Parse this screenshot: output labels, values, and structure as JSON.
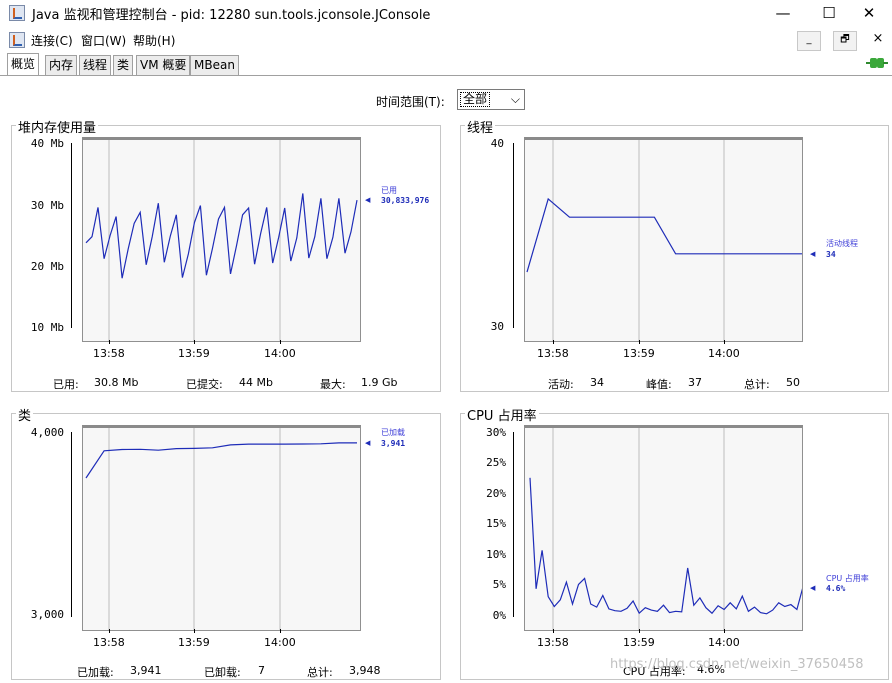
{
  "window": {
    "title": "Java 监视和管理控制台 - pid: 12280 sun.tools.jconsole.JConsole",
    "minimize": "—",
    "maximize": "☐",
    "close": "✕"
  },
  "menu": {
    "connect": "连接(C)",
    "window": "窗口(W)",
    "help": "帮助(H)",
    "mdi_min": "_",
    "mdi_restore": "🗗",
    "mdi_close": "×"
  },
  "tabs": [
    "概览",
    "内存",
    "线程",
    "类",
    "VM 概要",
    "MBean"
  ],
  "active_tab": "概览",
  "time_range": {
    "label": "时间范围(T):",
    "value": "全部"
  },
  "panels": {
    "heap": {
      "title": "堆内存使用量",
      "y_ticks": [
        "40 Mb",
        "30 Mb",
        "20 Mb",
        "10 Mb"
      ],
      "x_ticks": [
        "13:58",
        "13:59",
        "14:00"
      ],
      "legend_name": "已用",
      "legend_value": "30,833,976",
      "stats": {
        "used_label": "已用:",
        "used_value": "30.8 Mb",
        "committed_label": "已提交:",
        "committed_value": "44 Mb",
        "max_label": "最大:",
        "max_value": "1.9 Gb"
      }
    },
    "threads": {
      "title": "线程",
      "y_ticks": [
        "40",
        "30"
      ],
      "x_ticks": [
        "13:58",
        "13:59",
        "14:00"
      ],
      "legend_name": "活动线程",
      "legend_value": "34",
      "stats": {
        "live_label": "活动:",
        "live_value": "34",
        "peak_label": "峰值:",
        "peak_value": "37",
        "total_label": "总计:",
        "total_value": "50"
      }
    },
    "classes": {
      "title": "类",
      "y_ticks": [
        "4,000",
        "3,000"
      ],
      "x_ticks": [
        "13:58",
        "13:59",
        "14:00"
      ],
      "legend_name": "已加载",
      "legend_value": "3,941",
      "stats": {
        "loaded_label": "已加载:",
        "loaded_value": "3,941",
        "unloaded_label": "已卸载:",
        "unloaded_value": "7",
        "total_label": "总计:",
        "total_value": "3,948"
      }
    },
    "cpu": {
      "title": "CPU 占用率",
      "y_ticks": [
        "30%",
        "25%",
        "20%",
        "15%",
        "10%",
        "5%",
        "0%"
      ],
      "x_ticks": [
        "13:58",
        "13:59",
        "14:00"
      ],
      "legend_name": "CPU 占用率",
      "legend_value": "4.6%",
      "stats": {
        "cpu_label": "CPU 占用率:",
        "cpu_value": "4.6%"
      }
    }
  },
  "watermark": "https://blog.csdn.net/weixin_37650458",
  "colors": {
    "series": "#1e2cb8",
    "plot_bg": "#f7f7f7",
    "grid": "#bdbdbd",
    "connected_icon": "#3aa83a"
  },
  "chart_data": [
    {
      "type": "line",
      "title": "堆内存使用量",
      "ylabel": "Mb",
      "ylim": [
        10,
        40
      ],
      "x_ticks": [
        "13:58",
        "13:59",
        "14:00"
      ],
      "series": [
        {
          "name": "已用",
          "values": [
            23.8,
            24.8,
            29.6,
            21.2,
            25.0,
            28.1,
            18.0,
            22.8,
            27.0,
            28.8,
            20.2,
            24.8,
            30.3,
            20.6,
            24.9,
            28.4,
            18.1,
            22.0,
            27.1,
            29.9,
            18.5,
            22.9,
            27.7,
            29.6,
            18.7,
            23.4,
            28.4,
            29.5,
            20.3,
            25.3,
            29.6,
            20.5,
            24.7,
            29.5,
            20.8,
            24.6,
            31.9,
            21.3,
            24.8,
            31.1,
            21.2,
            24.7,
            31.1,
            22.1,
            25.6,
            30.8
          ]
        }
      ]
    },
    {
      "type": "line",
      "title": "线程",
      "ylim": [
        30,
        40
      ],
      "x_ticks": [
        "13:58",
        "13:59",
        "14:00"
      ],
      "series": [
        {
          "name": "活动线程",
          "values": [
            33.0,
            37.0,
            36.0,
            36.0,
            36.0,
            36.0,
            36.0,
            34.0,
            34.0,
            34.0,
            34.0,
            34.0,
            34.0,
            34.0
          ]
        }
      ]
    },
    {
      "type": "line",
      "title": "类",
      "ylim": [
        3000,
        4000
      ],
      "x_ticks": [
        "13:58",
        "13:59",
        "14:00"
      ],
      "series": [
        {
          "name": "已加载",
          "values": [
            3750,
            3898,
            3905,
            3906,
            3901,
            3910,
            3911,
            3914,
            3930,
            3934,
            3934,
            3934,
            3935,
            3936,
            3941,
            3941
          ]
        }
      ]
    },
    {
      "type": "line",
      "title": "CPU 占用率",
      "ylabel": "%",
      "ylim": [
        0,
        30
      ],
      "x_ticks": [
        "13:58",
        "13:59",
        "14:00"
      ],
      "series": [
        {
          "name": "CPU 占用率",
          "values": [
            22.5,
            4.3,
            10.6,
            3.0,
            1.4,
            2.5,
            5.4,
            1.8,
            5.0,
            6.0,
            1.8,
            1.3,
            3.2,
            1.0,
            0.7,
            0.6,
            1.1,
            2.3,
            0.3,
            1.2,
            0.8,
            0.6,
            1.6,
            0.4,
            0.6,
            0.5,
            7.7,
            1.6,
            2.8,
            1.2,
            0.3,
            1.5,
            0.9,
            2.0,
            1.0,
            3.1,
            0.6,
            1.3,
            0.4,
            0.2,
            0.8,
            2.0,
            1.4,
            1.7,
            0.9,
            4.6
          ]
        }
      ]
    }
  ]
}
